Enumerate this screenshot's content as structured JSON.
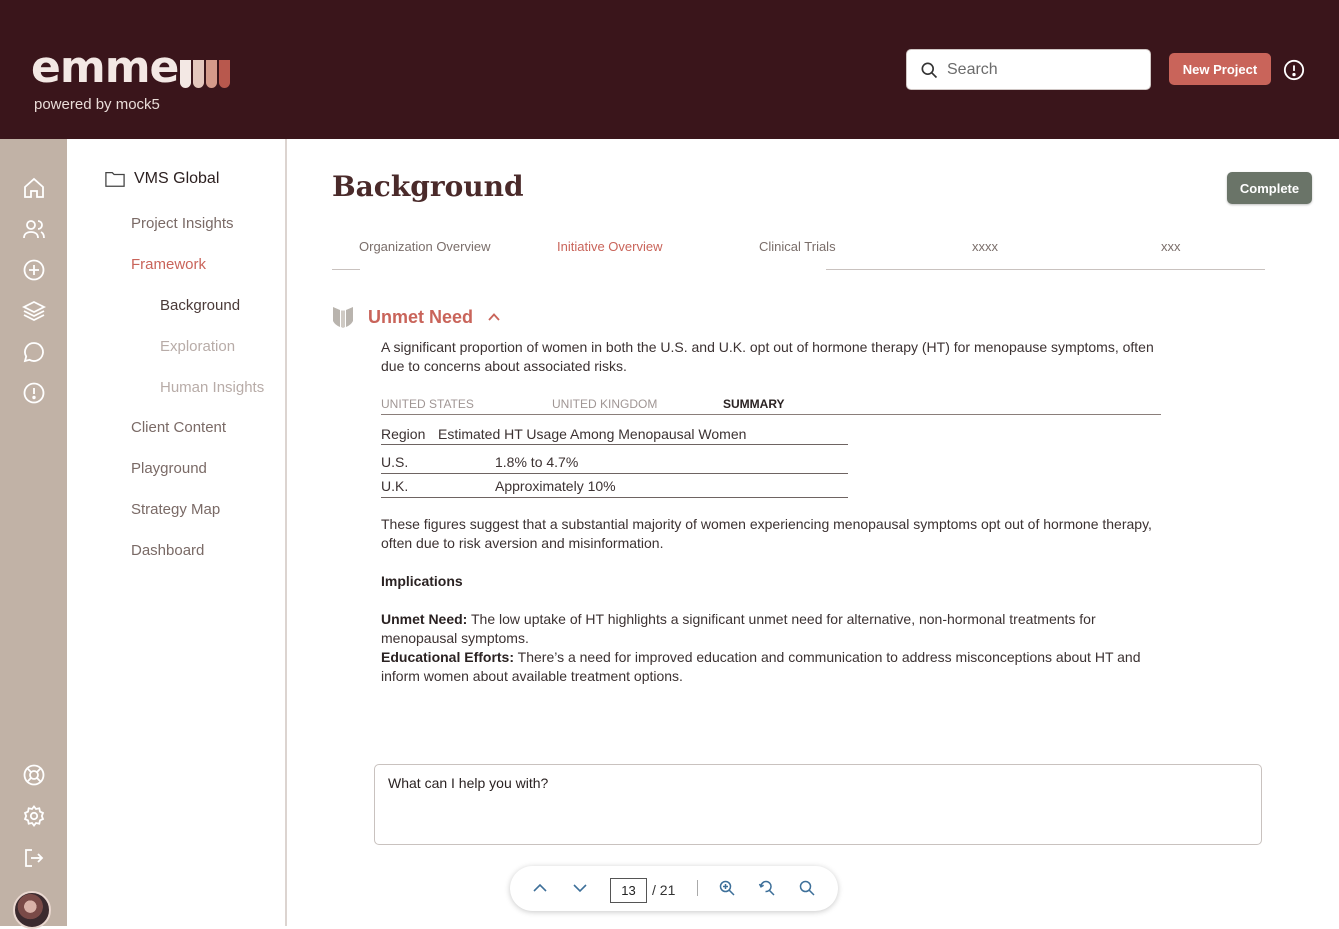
{
  "header": {
    "logo_text": "emme",
    "powered_by": "powered by mock5",
    "search_placeholder": "Search",
    "new_project_label": "New Project",
    "colors": {
      "header_bg": "#3a151b",
      "accent": "#c9645a"
    }
  },
  "rail": {
    "icons": [
      "home-icon",
      "users-icon",
      "plus-circle-icon",
      "layers-icon",
      "chat-icon",
      "alert-icon",
      "lifebuoy-icon",
      "gear-icon",
      "logout-icon"
    ]
  },
  "nav": {
    "project": "VMS Global",
    "items": [
      {
        "label": "Project Insights",
        "state": "normal"
      },
      {
        "label": "Framework",
        "state": "active"
      },
      {
        "label": "Background",
        "state": "current"
      },
      {
        "label": "Exploration",
        "state": "faded"
      },
      {
        "label": "Human Insights",
        "state": "faded"
      },
      {
        "label": "Client Content",
        "state": "normal"
      },
      {
        "label": "Playground",
        "state": "normal"
      },
      {
        "label": "Strategy Map",
        "state": "normal"
      },
      {
        "label": "Dashboard",
        "state": "normal"
      }
    ]
  },
  "main": {
    "title": "Background",
    "complete_label": "Complete",
    "tabs": [
      {
        "label": "Organization Overview"
      },
      {
        "label": "Initiative Overview",
        "active": true
      },
      {
        "label": "Clinical Trials"
      },
      {
        "label": "xxxx"
      },
      {
        "label": "xxx"
      }
    ],
    "section": {
      "title": "Unmet Need",
      "intro": "A significant proportion of women in both the U.S. and U.K. opt out of hormone therapy (HT) for menopause symptoms, often due to concerns about associated risks.",
      "subtabs": [
        "UNITED STATES",
        "UNITED KINGDOM",
        "SUMMARY"
      ],
      "active_subtab": "SUMMARY",
      "table": {
        "headers": [
          "Region",
          "Estimated HT Usage Among Menopausal Women"
        ],
        "rows": [
          [
            "U.S.",
            "1.8% to 4.7%"
          ],
          [
            "U.K.",
            "Approximately 10%"
          ]
        ]
      },
      "summary": "These figures suggest that a substantial majority of women experiencing menopausal symptoms opt out of hormone therapy, often due to risk aversion and misinformation.",
      "implications_heading": "Implications",
      "implications": [
        {
          "label": "Unmet Need:",
          "text": " The low uptake of HT highlights a significant unmet need for alternative, non-hormonal treatments for menopausal symptoms."
        },
        {
          "label": "Educational Efforts:",
          "text": " There’s a need for improved education and communication to address misconceptions about HT and inform women about available treatment options."
        }
      ]
    },
    "chat_placeholder": "What can I help you with?",
    "pager": {
      "current_page": "13",
      "total": "/ 21"
    }
  }
}
